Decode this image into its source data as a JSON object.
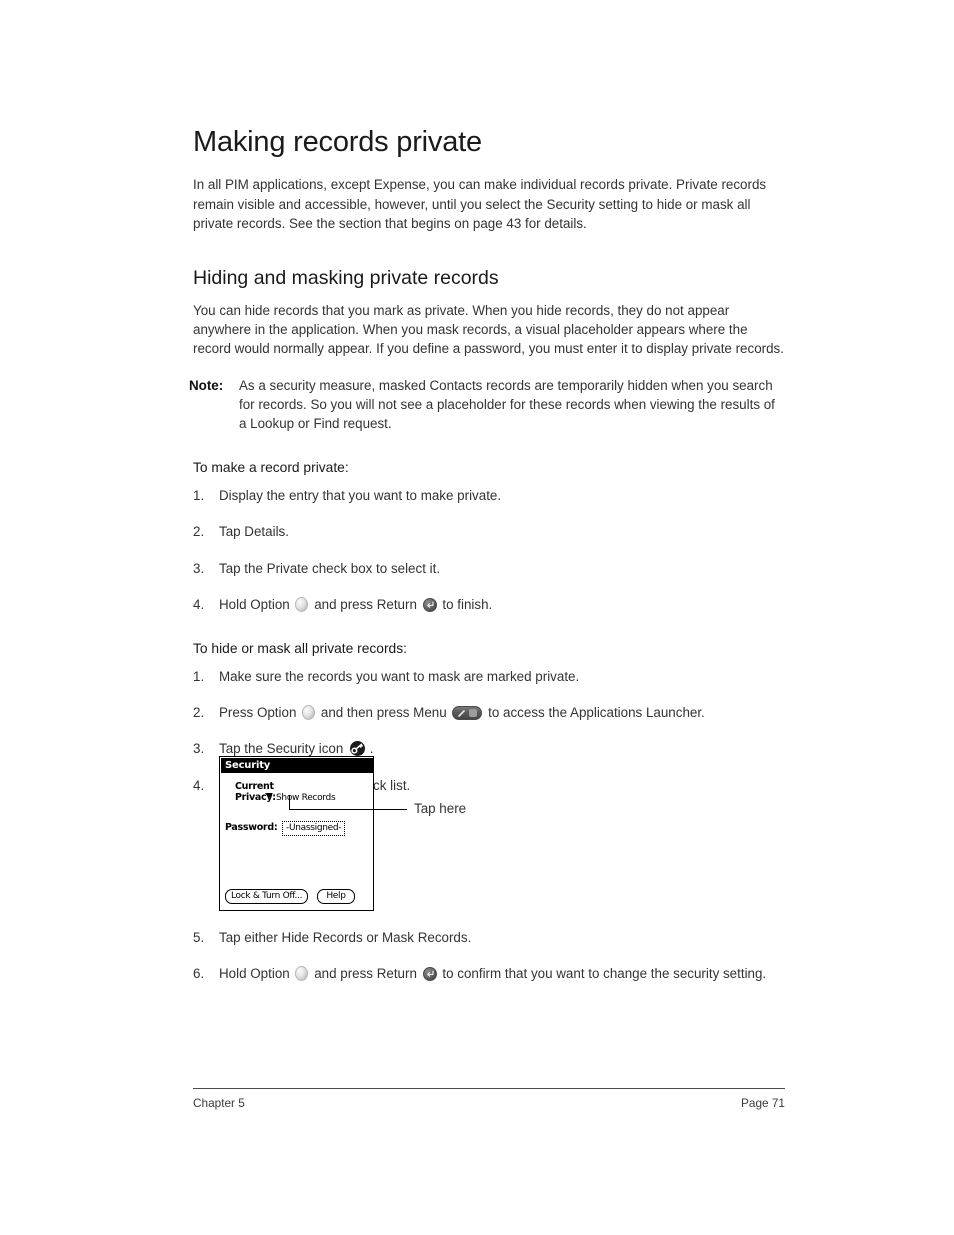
{
  "document": {
    "title": "Making records private",
    "intro": "In all PIM applications, except Expense, you can make individual records private. Private records remain visible and accessible, however, until you select the Security setting to hide or mask all private records. See the section that begins on page 43 for details."
  },
  "section": {
    "heading": "Hiding and masking private records",
    "paragraph": "You can hide records that you mark as private. When you hide records, they do not appear anywhere in the application. When you mask records, a visual placeholder appears where the record would normally appear. If you define a password, you must enter it to display private records.",
    "note_label": "Note:",
    "note_text": "As a security measure, masked Contacts records are temporarily hidden when you search for records. So you will not see a placeholder for these records when viewing the results of a Lookup or Find request."
  },
  "procedure_one": {
    "heading": "To make a record private:",
    "steps": [
      {
        "num": "1.",
        "text": "Display the entry that you want to make private."
      },
      {
        "num": "2.",
        "text": "Tap Details."
      },
      {
        "num": "3.",
        "text": "Tap the Private check box to select it."
      },
      {
        "num": "4.",
        "prefix": "Hold Option",
        "mid": "and press Return",
        "suffix": "to finish."
      }
    ]
  },
  "procedure_two": {
    "heading": "To hide or mask all private records:",
    "steps": [
      {
        "num": "1.",
        "text": "Make sure the records you want to mask are marked private."
      },
      {
        "num": "2.",
        "prefix": "Press Option",
        "mid": "and then press Menu",
        "suffix": "to access the Applications Launcher."
      },
      {
        "num": "3.",
        "prefix": "Tap the Security icon",
        "suffix": "."
      },
      {
        "num": "4.",
        "text": "Tap the Current Privacy pick list."
      }
    ],
    "steps_after": [
      {
        "num": "5.",
        "text": "Tap either Hide Records or Mask Records."
      },
      {
        "num": "6.",
        "prefix": "Hold Option",
        "mid": "and press Return",
        "suffix": "to confirm that you want to change the security setting."
      }
    ]
  },
  "figure": {
    "title": "Security",
    "label_current": "Current",
    "label_privacy": "Privacy:",
    "picklist_value": "Show Records",
    "label_password": "Password:",
    "password_value": "-Unassigned-",
    "button_lock": "Lock & Turn Off...",
    "button_help": "Help",
    "callout": "Tap here"
  },
  "footer": {
    "chapter": "Chapter 5",
    "page": "Page 71"
  },
  "icons": {
    "option_key": "option-key-icon",
    "return_key": "return-key-icon",
    "menu_key": "menu-key-icon",
    "security": "security-key-icon",
    "picklist_arrow": "chevron-down-icon"
  },
  "colors": {
    "text": "#333333",
    "heading": "#1a1a1a",
    "titlebar": "#000000",
    "rule": "#4a4a4a"
  }
}
